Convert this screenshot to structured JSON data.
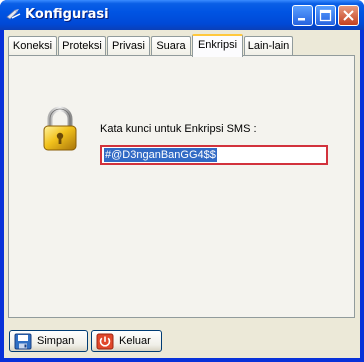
{
  "window": {
    "title": "Konfigurasi"
  },
  "tabs": [
    {
      "label": "Koneksi"
    },
    {
      "label": "Proteksi"
    },
    {
      "label": "Privasi"
    },
    {
      "label": "Suara"
    },
    {
      "label": "Enkripsi"
    },
    {
      "label": "Lain-lain"
    }
  ],
  "active_tab": "Enkripsi",
  "encryption": {
    "prompt": "Kata kunci untuk Enkripsi SMS :",
    "key_value": "#@D3nganBanGG4$$"
  },
  "buttons": {
    "save": "Simpan",
    "exit": "Keluar"
  },
  "colors": {
    "titlebar": "#0054e3",
    "client_bg": "#ece9d8",
    "active_tab_accent": "#ffc83c",
    "field_border": "#d2323c",
    "selection": "#316ac5"
  },
  "icons": [
    "window-app-icon",
    "minimize-icon",
    "maximize-icon",
    "close-icon",
    "padlock-icon",
    "save-disk-icon",
    "exit-icon"
  ]
}
